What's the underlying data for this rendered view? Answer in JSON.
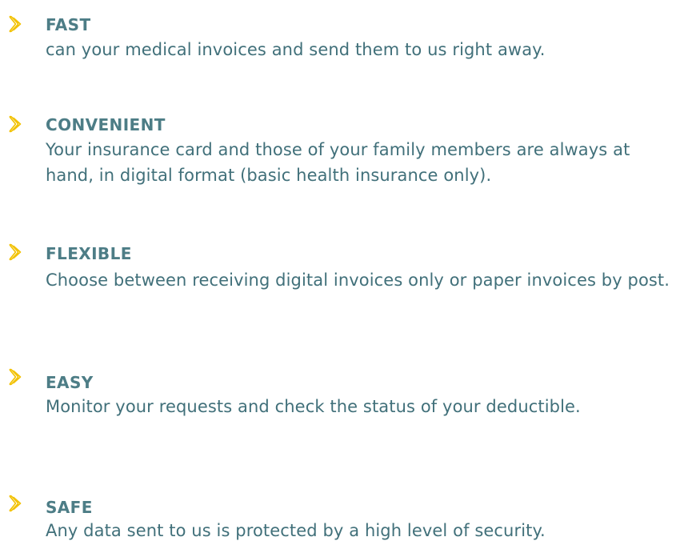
{
  "colors": {
    "accent": "#f2c100",
    "heading": "#4d7d86",
    "text": "#41707a"
  },
  "features": [
    {
      "icon": "chevron-right-icon",
      "title": "FAST",
      "description": "can your medical invoices and send them to us right away."
    },
    {
      "icon": "chevron-right-icon",
      "title": "CONVENIENT",
      "description": "Your insurance card and those of your family members are always at hand, in digital format (basic health insurance only)."
    },
    {
      "icon": "chevron-right-icon",
      "title": "FLEXIBLE",
      "description": "Choose between receiving digital invoices only or paper invoices by post."
    },
    {
      "icon": "chevron-right-icon",
      "title": "EASY",
      "description": "Monitor your requests and check the status of your deductible."
    },
    {
      "icon": "chevron-right-icon",
      "title": "SAFE",
      "description": "Any data sent to us is protected by a high level of security."
    }
  ]
}
